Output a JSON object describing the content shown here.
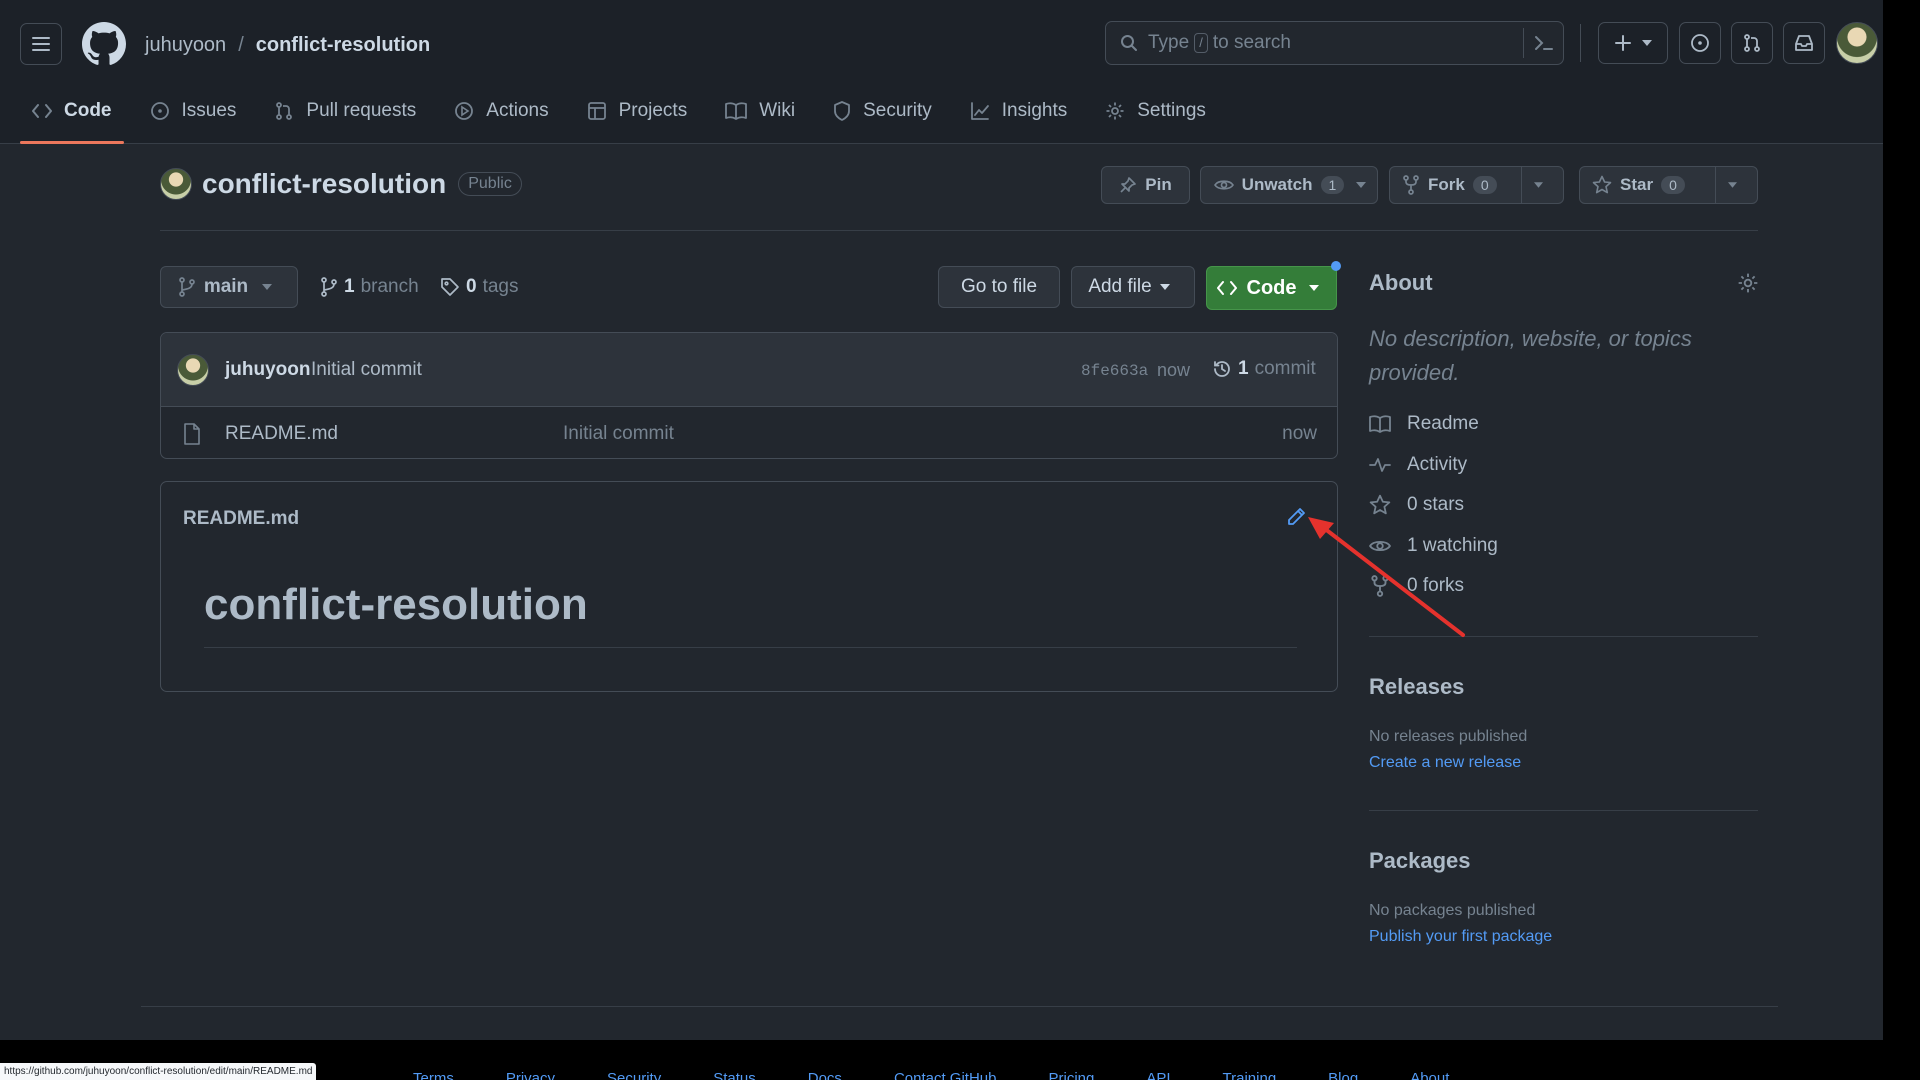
{
  "header": {
    "owner": "juhuyoon",
    "separator": "/",
    "repo": "conflict-resolution",
    "search": {
      "pre": "Type",
      "key": "/",
      "post": "to search"
    }
  },
  "tabs": [
    {
      "label": "Code",
      "icon": "code-icon",
      "active": true
    },
    {
      "label": "Issues",
      "icon": "issue-icon"
    },
    {
      "label": "Pull requests",
      "icon": "pull-request-icon"
    },
    {
      "label": "Actions",
      "icon": "play-icon"
    },
    {
      "label": "Projects",
      "icon": "table-icon"
    },
    {
      "label": "Wiki",
      "icon": "book-icon"
    },
    {
      "label": "Security",
      "icon": "shield-icon"
    },
    {
      "label": "Insights",
      "icon": "graph-icon"
    },
    {
      "label": "Settings",
      "icon": "gear-icon"
    }
  ],
  "repo": {
    "name": "conflict-resolution",
    "visibility": "Public",
    "pin_label": "Pin",
    "unwatch_label": "Unwatch",
    "unwatch_count": "1",
    "fork_label": "Fork",
    "fork_count": "0",
    "star_label": "Star",
    "star_count": "0"
  },
  "toolbar": {
    "branch": "main",
    "branch_count": "1",
    "branch_word": "branch",
    "tag_count": "0",
    "tag_word": "tags",
    "go_to_file": "Go to file",
    "add_file": "Add file",
    "code": "Code"
  },
  "commit": {
    "author": "juhuyoon",
    "message": "Initial commit",
    "sha": "8fe663a",
    "time": "now",
    "count": "1",
    "count_word": "commit"
  },
  "files": [
    {
      "name": "README.md",
      "message": "Initial commit",
      "time": "now"
    }
  ],
  "readme": {
    "filename": "README.md",
    "heading": "conflict-resolution"
  },
  "about": {
    "title": "About",
    "description": "No description, website, or topics provided.",
    "items": [
      {
        "icon": "book-icon",
        "label": "Readme"
      },
      {
        "icon": "pulse-icon",
        "label": "Activity"
      },
      {
        "icon": "star-icon",
        "label": "0 stars"
      },
      {
        "icon": "eye-icon",
        "label": "1 watching"
      },
      {
        "icon": "fork-icon",
        "label": "0 forks"
      }
    ]
  },
  "releases": {
    "title": "Releases",
    "empty": "No releases published",
    "link": "Create a new release"
  },
  "packages": {
    "title": "Packages",
    "empty": "No packages published",
    "link": "Publish your first package"
  },
  "statusbar": "https://github.com/juhuyoon/conflict-resolution/edit/main/README.md",
  "footer": [
    "Terms",
    "Privacy",
    "Security",
    "Status",
    "Docs",
    "Contact GitHub",
    "Pricing",
    "API",
    "Training",
    "Blog",
    "About"
  ],
  "colors": {
    "accent_underline": "#ec775c",
    "code_button": "#347d39",
    "link": "#539bf5",
    "annotation_arrow": "#e5322d"
  }
}
